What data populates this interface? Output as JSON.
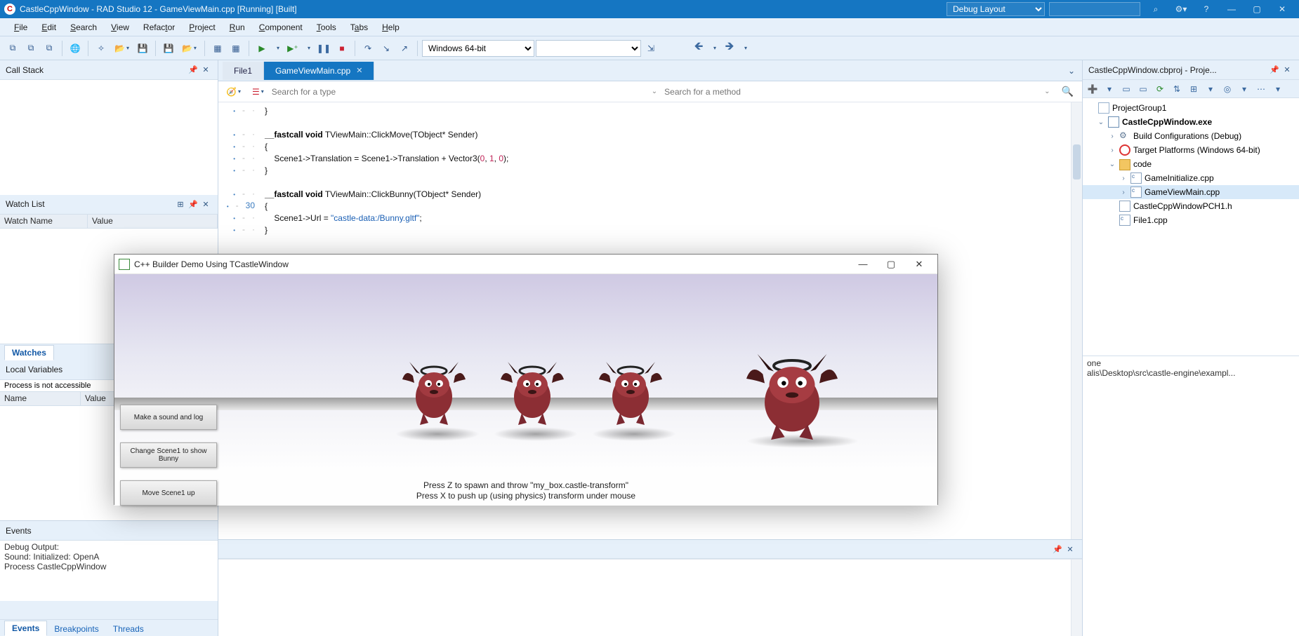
{
  "titlebar": {
    "title": "CastleCppWindow - RAD Studio 12 - GameViewMain.cpp [Running] [Built]",
    "layout_combo": "Debug Layout",
    "search_placeholder": ""
  },
  "menu": [
    "File",
    "Edit",
    "Search",
    "View",
    "Refactor",
    "Project",
    "Run",
    "Component",
    "Tools",
    "Tabs",
    "Help"
  ],
  "toolbar": {
    "platform": "Windows 64-bit"
  },
  "left": {
    "callstack": {
      "title": "Call Stack"
    },
    "watch": {
      "title": "Watch List",
      "cols": [
        "Watch Name",
        "Value"
      ],
      "tab": "Watches"
    },
    "locals": {
      "title": "Local Variables",
      "msg": "Process is not accessible",
      "cols": [
        "Name",
        "Value"
      ]
    }
  },
  "editor": {
    "tabs": {
      "file1": "File1",
      "active": "GameViewMain.cpp"
    },
    "search_type_ph": "Search for a type",
    "search_method_ph": "Search for a method",
    "lines": [
      "}",
      "",
      "__fastcall void TViewMain::ClickMove(TObject* Sender)",
      "{",
      "    Scene1->Translation = Scene1->Translation + Vector3(0, 1, 0);",
      "}",
      "",
      "__fastcall void TViewMain::ClickBunny(TObject* Sender)",
      "{",
      "    Scene1->Url = \"castle-data:/Bunny.gltf\";",
      "}"
    ],
    "line30": "30"
  },
  "project": {
    "title": "CastleCppWindow.cbproj - Proje...",
    "nodes": {
      "group": "ProjectGroup1",
      "exe": "CastleCppWindow.exe",
      "build": "Build Configurations (Debug)",
      "target": "Target Platforms (Windows 64-bit)",
      "code": "code",
      "ginit": "GameInitialize.cpp",
      "gvm": "GameViewMain.cpp",
      "pch": "CastleCppWindowPCH1.h",
      "f1": "File1.cpp"
    },
    "sel1": "one",
    "sel2": "alis\\Desktop\\src\\castle-engine\\exampl..."
  },
  "events": {
    "title": "Events",
    "lines": [
      "Debug Output:",
      "Sound: Initialized: OpenA",
      "",
      "Process CastleCppWindow"
    ],
    "tabs": [
      "Events",
      "Breakpoints",
      "Threads"
    ]
  },
  "runwin": {
    "title": "C++ Builder Demo Using TCastleWindow",
    "buttons": [
      "Make a sound and log",
      "Change Scene1 to show Bunny",
      "Move Scene1 up"
    ],
    "hints": [
      "Press Z to spawn and throw \"my_box.castle-transform\"",
      "Press X to push up (using physics) transform under mouse"
    ]
  }
}
